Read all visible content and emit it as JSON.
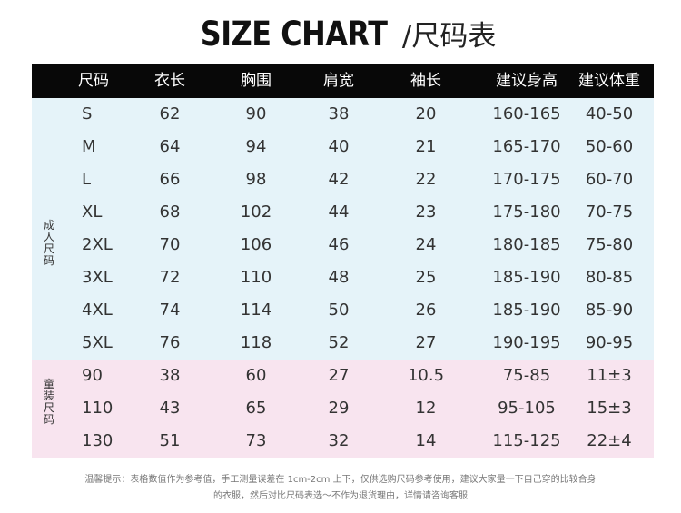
{
  "title": {
    "en": "SIZE CHART",
    "sep": "/",
    "cn": "尺码表"
  },
  "columns": [
    "尺码",
    "衣长",
    "胸围",
    "肩宽",
    "袖长",
    "建议身高",
    "建议体重"
  ],
  "groups": {
    "adult": "成人尺码",
    "kids": "童装尺码"
  },
  "adult_rows": [
    [
      "S",
      "62",
      "90",
      "38",
      "20",
      "160-165",
      "40-50"
    ],
    [
      "M",
      "64",
      "94",
      "40",
      "21",
      "165-170",
      "50-60"
    ],
    [
      "L",
      "66",
      "98",
      "42",
      "22",
      "170-175",
      "60-70"
    ],
    [
      "XL",
      "68",
      "102",
      "44",
      "23",
      "175-180",
      "70-75"
    ],
    [
      "2XL",
      "70",
      "106",
      "46",
      "24",
      "180-185",
      "75-80"
    ],
    [
      "3XL",
      "72",
      "110",
      "48",
      "25",
      "185-190",
      "80-85"
    ],
    [
      "4XL",
      "74",
      "114",
      "50",
      "26",
      "185-190",
      "85-90"
    ],
    [
      "5XL",
      "76",
      "118",
      "52",
      "27",
      "190-195",
      "90-95"
    ]
  ],
  "kids_rows": [
    [
      "90",
      "38",
      "60",
      "27",
      "10.5",
      "75-85",
      "11±3"
    ],
    [
      "110",
      "43",
      "65",
      "29",
      "12",
      "95-105",
      "15±3"
    ],
    [
      "130",
      "51",
      "73",
      "32",
      "14",
      "115-125",
      "22±4"
    ]
  ],
  "note": {
    "line1": "温馨提示：表格数值作为参考值，手工测量误差在 1cm-2cm 上下，仅供选购尺码参考使用，建议大家量一下自己穿的比较合身",
    "line2": "的衣服，然后对比尺码表选～不作为退货理由，详情请咨询客服"
  },
  "colors": {
    "header_bg": "#080808",
    "adult_band": "#e5f3f9",
    "kids_band": "#f8e4ef"
  }
}
